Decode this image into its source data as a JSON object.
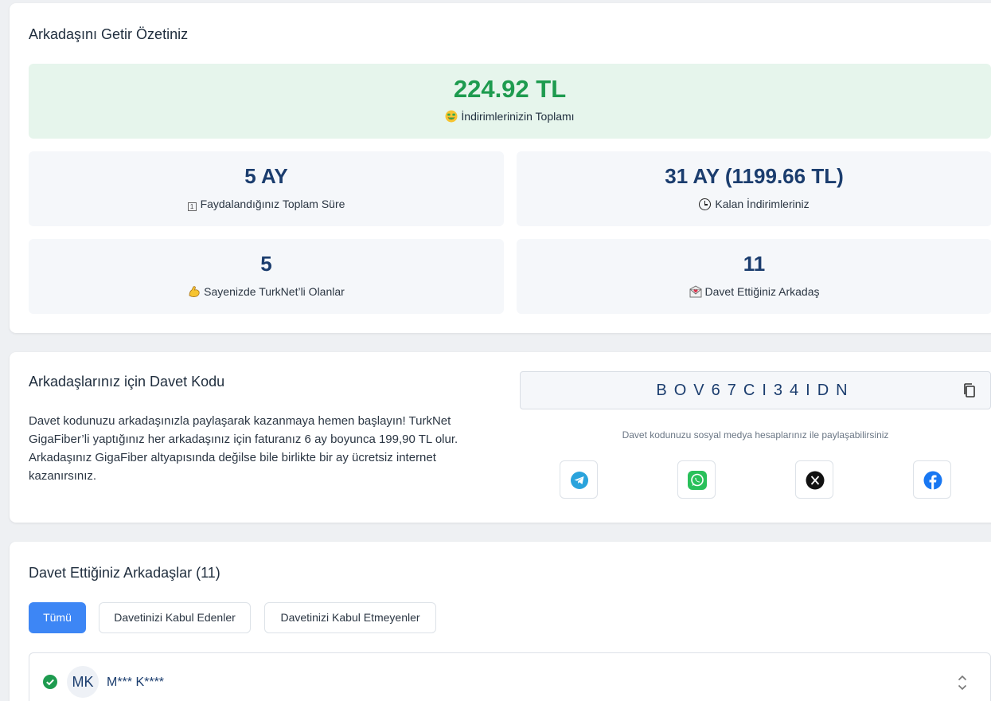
{
  "summary": {
    "title": "Arkadaşını Getir Özetiniz",
    "total_amount": "224.92 TL",
    "total_label": "İndirimlerinizin Toplamı",
    "stats": [
      {
        "value": "5 AY",
        "label": "Faydalandığınız Toplam Süre",
        "icon": "calendar-icon"
      },
      {
        "value": "31 AY (1199.66 TL)",
        "label": "Kalan İndirimleriniz",
        "icon": "clock-icon"
      },
      {
        "value": "5",
        "label": "Sayenizde TurkNet’li Olanlar",
        "icon": "flexed-arm-icon"
      },
      {
        "value": "11",
        "label": "Davet Ettiğiniz Arkadaş",
        "icon": "envelope-heart-icon"
      }
    ]
  },
  "invite": {
    "title": "Arkadaşlarınız için Davet Kodu",
    "description": "Davet kodunuzu arkadaşınızla paylaşarak kazanmaya hemen başlayın! TurkNet GigaFiber’li yaptığınız her arkadaşınız için faturanız 6 ay boyunca 199,90 TL olur. Arkadaşınız GigaFiber altyapısında değilse bile birlikte bir ay ücretsiz internet kazanırsınız.",
    "code": "BOV67CI34IDN",
    "share_hint": "Davet kodunuzu sosyal medya hesaplarınız ile paylaşabilirsiniz",
    "share_buttons": [
      "telegram-icon",
      "whatsapp-icon",
      "x-icon",
      "facebook-icon"
    ]
  },
  "friends": {
    "title": "Davet Ettiğiniz Arkadaşlar (11)",
    "filters": [
      "Tümü",
      "Davetinizi Kabul Edenler",
      "Davetinizi Kabul Etmeyenler"
    ],
    "active_filter": "Tümü",
    "rows": [
      {
        "initials": "MK",
        "name": "M*** K****",
        "accepted": true
      }
    ]
  },
  "colors": {
    "accent": "#3d86f5",
    "success": "#1e9b4f",
    "navy": "#1b3d6e"
  }
}
